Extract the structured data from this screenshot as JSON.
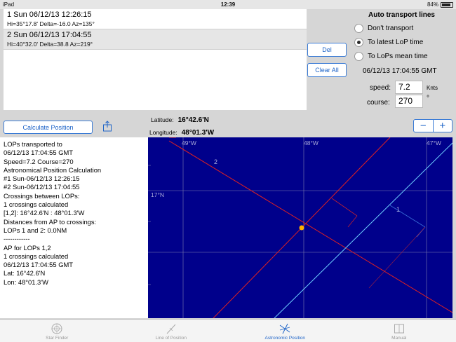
{
  "status": {
    "device": "iPad",
    "time": "12:39",
    "battery": "84%"
  },
  "lops": [
    {
      "line1": "1 Sun 06/12/13 12:26:15",
      "line2": "Hi=35°17.8'  Delta=-16.0  Az=135°"
    },
    {
      "line1": "2 Sun 06/12/13 17:04:55",
      "line2": "Hi=40°32.0'  Delta=38.8  Az=219°"
    }
  ],
  "buttons": {
    "del": "Del",
    "clear_all": "Clear All",
    "calculate": "Calculate Position"
  },
  "transport": {
    "title": "Auto transport lines",
    "options": [
      "Don't  transport",
      "To latest LoP time",
      "To LoPs mean time"
    ],
    "selected_index": 1,
    "datetime": "06/12/13 17:04:55 GMT",
    "speed_label": "speed:",
    "speed_value": "7.2",
    "speed_unit": "Knts",
    "course_label": "course:",
    "course_value": "270",
    "course_unit": "°"
  },
  "position": {
    "lat_label": "Latitude:",
    "lat_value": "16°42.6'N",
    "lon_label": "Longitude:",
    "lon_value": "48°01.3'W"
  },
  "zoom": {
    "minus": "−",
    "plus": "+"
  },
  "log_lines": [
    "LOPs transported to",
    "06/12/13 17:04:55 GMT",
    "Speed=7.2  Course=270",
    "Astronomical Position Calculation",
    "#1 Sun-06/12/13 12:26:15",
    "#2 Sun-06/12/13 17:04:55",
    "Crossings between LOPs:",
    "1 crossings calculated",
    "[1,2]: 16°42.6'N : 48°01.3'W",
    "Distances from AP to crossings:",
    "LOPs 1 and 2:  0.0NM",
    "------------",
    "AP for LOPs 1,2",
    "1 crossings calculated",
    "06/12/13 17:04:55 GMT",
    "Lat: 16°42.6'N",
    "Lon: 48°01.3'W"
  ],
  "chart": {
    "grid_labels": {
      "lon1": "49°W",
      "lon2": "48°W",
      "lon3": "47°W",
      "lat1": "17°N"
    },
    "line_labels": {
      "lop2": "2",
      "lop1": "1"
    },
    "colors": {
      "background": "#00008b",
      "lop_red": "#e02020",
      "lop_cyan": "#6fd0ff",
      "fix": "#ffb000",
      "grid": "#7f7fb0"
    }
  },
  "tabs": [
    {
      "label": "Star Finder",
      "icon": "star-finder-icon"
    },
    {
      "label": "Line of Position",
      "icon": "line-of-position-icon"
    },
    {
      "label": "Astronomic Position",
      "icon": "astronomic-position-icon"
    },
    {
      "label": "Manual",
      "icon": "manual-book-icon"
    }
  ],
  "active_tab": 2
}
